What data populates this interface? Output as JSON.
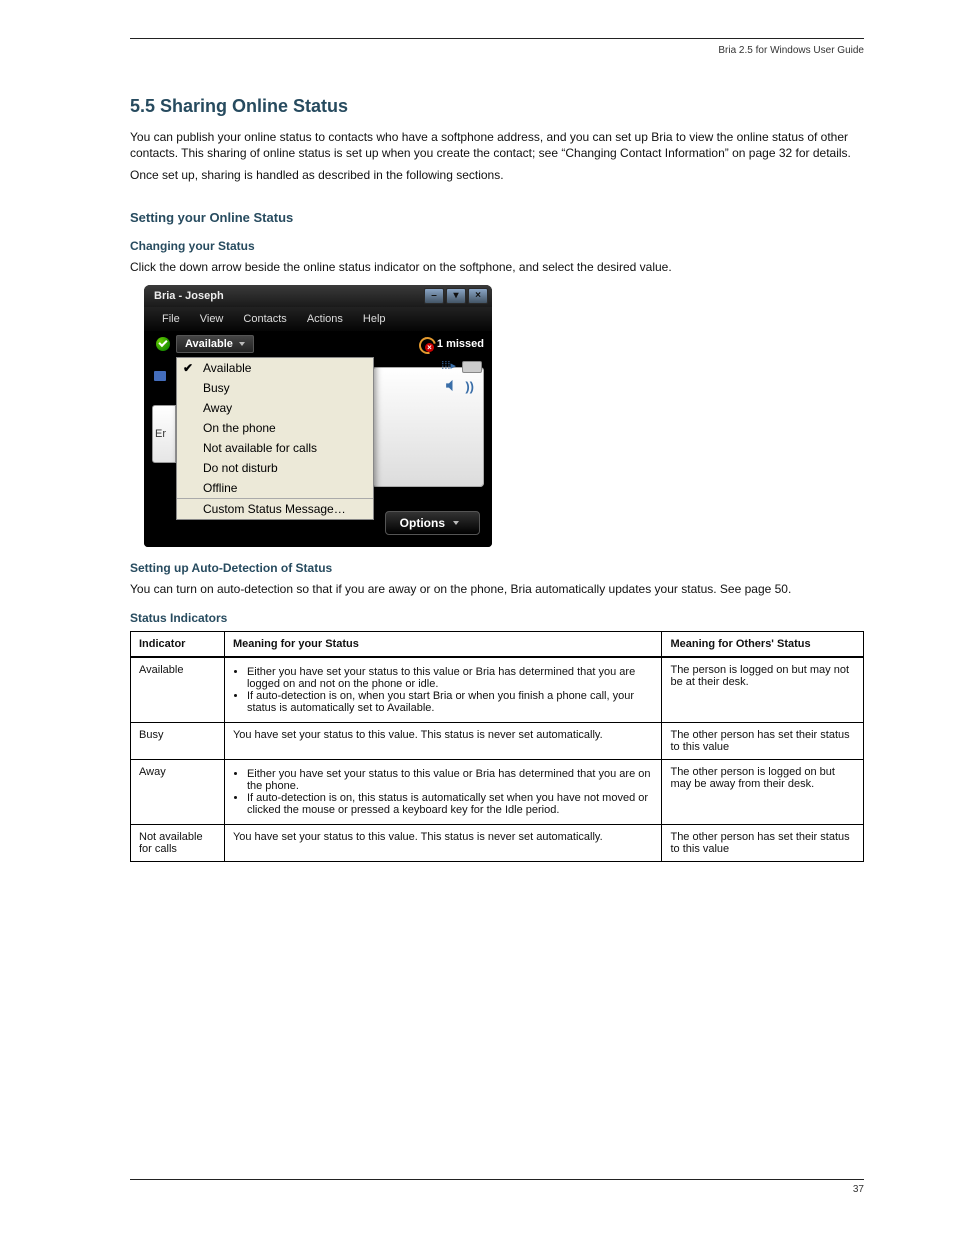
{
  "header": {
    "right_label": "Bria 2.5 for Windows User Guide"
  },
  "section": {
    "title": "5.5 Sharing Online Status",
    "intro_p1": "You can publish your online status to contacts who have a softphone address, and you can set up Bria to view the online status of other contacts. This sharing of online status is set up when you create the contact; see “Changing Contact Information” on page 32 for details.",
    "intro_p2": "Once set up, sharing is handled as described in the following sections.",
    "subheading": "Setting your Online Status",
    "sub_a": "Changing your Status",
    "sub_a_body": "Click the down arrow beside the online status indicator on the softphone, and select the desired value."
  },
  "bria": {
    "title": "Bria - Joseph",
    "menu": [
      "File",
      "View",
      "Contacts",
      "Actions",
      "Help"
    ],
    "status_label": "Available",
    "missed": "1 missed",
    "left_snippet": "Er",
    "options": "Options",
    "dropdown": [
      "Available",
      "Busy",
      "Away",
      "On the phone",
      "Not available for calls",
      "Do not disturb",
      "Offline",
      "Custom Status Message…"
    ]
  },
  "auto_detect_heading": "Setting up Auto-Detection of Status",
  "auto_detect_body": "You can turn on auto-detection so that if you are away or on the phone, Bria automatically updates your status. See page 50.",
  "table_heading": "Status Indicators",
  "table": {
    "cols": [
      "Indicator",
      "Meaning for your Status",
      "Meaning for Others' Status"
    ],
    "rows": [
      {
        "c1": "Available",
        "c2_lines": [
          "Either you have set your status to this value or Bria has determined that you are logged on and not on the phone or idle.",
          "If auto-detection is on, when you start Bria or when you finish a phone call, your status is automatically set to Available."
        ],
        "c3": "The person is logged on but may not be at their desk."
      },
      {
        "c1": "Busy",
        "c2_lines": [
          "You have set your status to this value. This status is never set automatically."
        ],
        "c3": "The other person has set their status to this value"
      },
      {
        "c1": "Away",
        "c2_lines": [
          "Either you have set your status to this value or Bria has determined that you are on the phone.",
          "If auto-detection is on, this status is automatically set when you have not moved or clicked the mouse or pressed a keyboard key for the Idle period."
        ],
        "c3": "The other person is logged on but may be away from their desk."
      },
      {
        "c1": "Not available for calls",
        "c2_lines": [
          "You have set your status to this value. This status is never set automatically."
        ],
        "c3": "The other person has set their status to this value"
      }
    ]
  },
  "footer": {
    "page": "37"
  }
}
